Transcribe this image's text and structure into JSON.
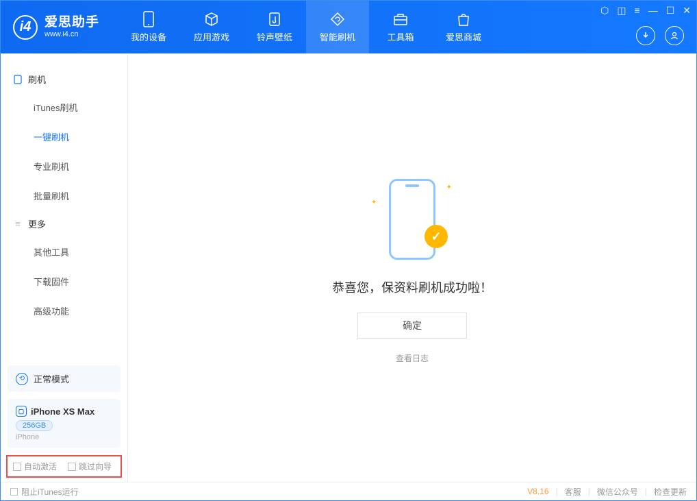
{
  "app": {
    "title": "爱思助手",
    "subtitle": "www.i4.cn"
  },
  "nav": {
    "device": "我的设备",
    "apps": "应用游戏",
    "ring": "铃声壁纸",
    "flash": "智能刷机",
    "tools": "工具箱",
    "store": "爱思商城"
  },
  "sidebar": {
    "sec1": "刷机",
    "items1": {
      "itunes": "iTunes刷机",
      "oneclick": "一键刷机",
      "pro": "专业刷机",
      "batch": "批量刷机"
    },
    "sec2": "更多",
    "items2": {
      "other": "其他工具",
      "fw": "下载固件",
      "adv": "高级功能"
    },
    "mode": "正常模式",
    "device": {
      "name": "iPhone XS Max",
      "storage": "256GB",
      "type": "iPhone"
    },
    "opts": {
      "auto": "自动激活",
      "skip": "跳过向导"
    }
  },
  "main": {
    "message": "恭喜您，保资料刷机成功啦！",
    "ok": "确定",
    "loglink": "查看日志"
  },
  "footer": {
    "block": "阻止iTunes运行",
    "version": "V8.16",
    "svc": "客服",
    "wechat": "微信公众号",
    "update": "检查更新"
  }
}
